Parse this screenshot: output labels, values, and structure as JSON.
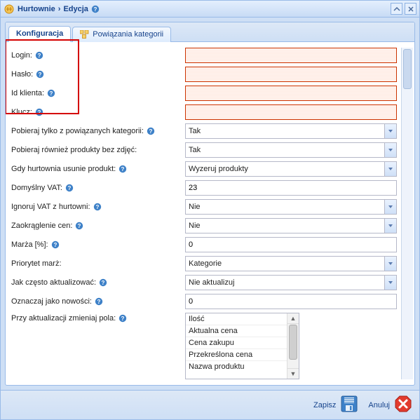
{
  "window": {
    "title_part1": "Hurtownie",
    "title_sep": "›",
    "title_part2": "Edycja"
  },
  "tabs": {
    "config": "Konfiguracja",
    "links": "Powiązania kategorii"
  },
  "labels": {
    "login": "Login:",
    "password": "Hasło:",
    "client_id": "Id klienta:",
    "key": "Klucz:",
    "only_linked": "Pobieraj tylko z powiązanych kategorii:",
    "no_photos": "Pobieraj również produkty bez zdjęć:",
    "on_remove": "Gdy hurtownia usunie produkt:",
    "default_vat": "Domyślny VAT:",
    "ignore_vat": "Ignoruj VAT z hurtowni:",
    "round_prices": "Zaokrąglenie cen:",
    "margin": "Marża [%]:",
    "margin_priority": "Priorytet marż:",
    "update_freq": "Jak często aktualizować:",
    "mark_new": "Oznaczaj jako nowości:",
    "update_fields": "Przy aktualizacji zmieniaj pola:"
  },
  "values": {
    "login": "",
    "password": "",
    "client_id": "",
    "key": "",
    "only_linked": "Tak",
    "no_photos": "Tak",
    "on_remove": "Wyzeruj produkty",
    "default_vat": "23",
    "ignore_vat": "Nie",
    "round_prices": "Nie",
    "margin": "0",
    "margin_priority": "Kategorie",
    "update_freq": "Nie aktualizuj",
    "mark_new": "0"
  },
  "multiselect": {
    "items": {
      "0": "Ilość",
      "1": "Aktualna cena",
      "2": "Cena zakupu",
      "3": "Przekreślona cena",
      "4": "Nazwa produktu"
    }
  },
  "footer": {
    "save": "Zapisz",
    "cancel": "Anuluj"
  },
  "colors": {
    "accent": "#99BBE8",
    "title_text": "#15428B",
    "error_border": "#C30",
    "highlight_box": "#D40000"
  }
}
